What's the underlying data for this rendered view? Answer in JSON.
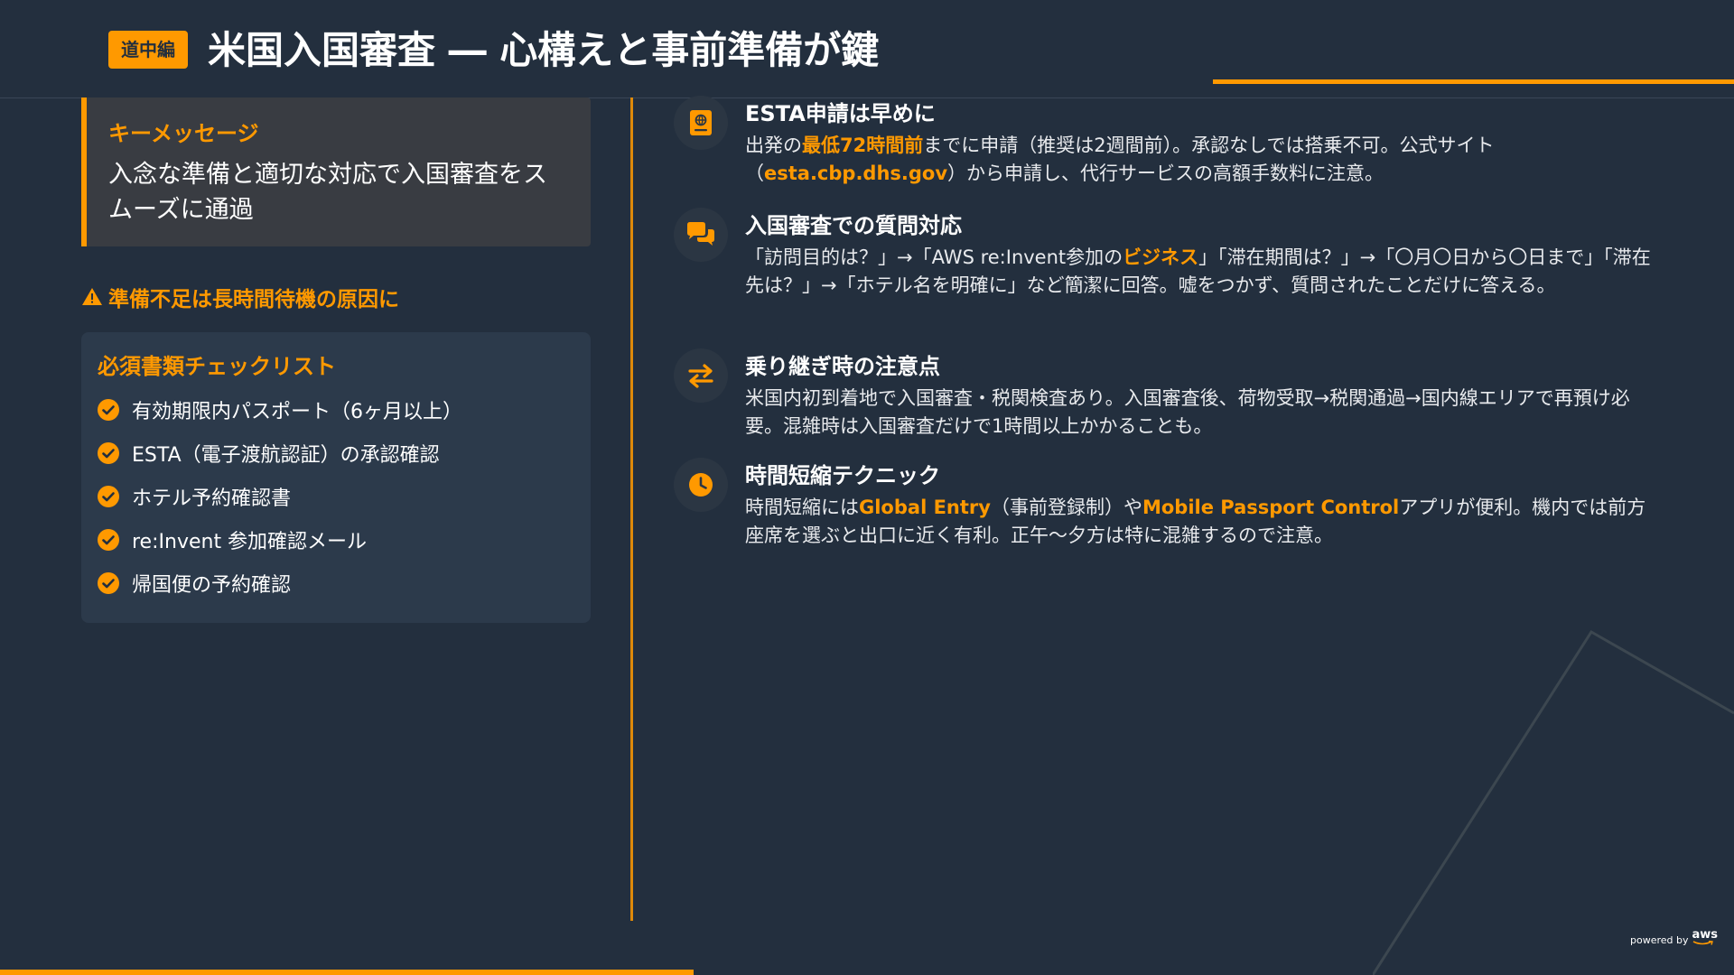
{
  "header": {
    "badge": "道中編",
    "title": "米国入国審査 ― 心構えと事前準備が鍵"
  },
  "key_message": {
    "label": "キーメッセージ",
    "text": "入念な準備と適切な対応で入国審査をスムーズに通過"
  },
  "warning": {
    "icon": "warning-triangle-icon",
    "text": "準備不足は長時間待機の原因に"
  },
  "checklist": {
    "title": "必須書類チェックリスト",
    "icon": "check-circle-icon",
    "items": [
      "有効期限内パスポート（6ヶ月以上）",
      "ESTA（電子渡航認証）の承認確認",
      "ホテル予約確認書",
      "re:Invent 参加確認メール",
      "帰国便の予約確認"
    ]
  },
  "sections": [
    {
      "icon": "passport-icon",
      "heading": "ESTA申請は早めに",
      "body": [
        {
          "t": "出発の"
        },
        {
          "t": "最低72時間前",
          "hl": true
        },
        {
          "t": "までに申請（推奨は2週間前）。承認なしでは搭乗不可。公式サイト（"
        },
        {
          "t": "esta.cbp.dhs.gov",
          "hl": true
        },
        {
          "t": "）から申請し、代行サービスの高額手数料に注意。"
        }
      ]
    },
    {
      "icon": "chat-bubbles-icon",
      "heading": "入国審査での質問対応",
      "body": [
        {
          "t": "「訪問目的は？」→「AWS re:Invent参加の"
        },
        {
          "t": "ビジネス",
          "hl": true
        },
        {
          "t": "」「滞在期間は？」→「〇月〇日から〇日まで」「滞在先は？」→「ホテル名を明確に」など簡潔に回答。嘘をつかず、質問されたことだけに答える。"
        }
      ]
    },
    {
      "icon": "transfer-arrows-icon",
      "heading": "乗り継ぎ時の注意点",
      "body": [
        {
          "t": "米国内初到着地で入国審査・税関検査あり。入国審査後、荷物受取→税関通過→国内線エリアで再預け必要。混雑時は入国審査だけで1時間以上かかることも。"
        }
      ]
    },
    {
      "icon": "clock-icon",
      "heading": "時間短縮テクニック",
      "body": [
        {
          "t": "時間短縮には"
        },
        {
          "t": "Global Entry",
          "hl": true
        },
        {
          "t": "（事前登録制）や"
        },
        {
          "t": "Mobile Passport Control",
          "hl": true
        },
        {
          "t": "アプリが便利。機内では前方座席を選ぶと出口に近く有利。正午〜夕方は特に混雑するので注意。"
        }
      ]
    }
  ],
  "footer": {
    "powered_by": "powered by",
    "brand": "aws"
  },
  "colors": {
    "background": "#232f3e",
    "accent": "#ff9900",
    "panel": "#2c3a4b",
    "key_panel": "#393c42"
  }
}
